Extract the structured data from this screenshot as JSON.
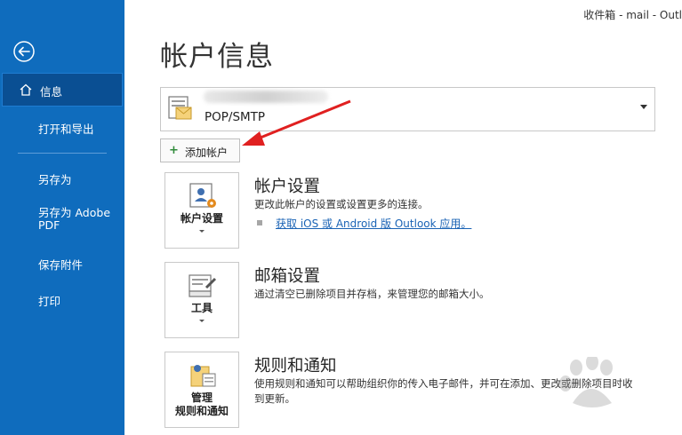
{
  "window": {
    "title": "收件箱 - mail - Outl"
  },
  "sidebar": {
    "items": [
      {
        "label": "信息"
      },
      {
        "label": "打开和导出"
      },
      {
        "label": "另存为"
      },
      {
        "label": "另存为 Adobe\nPDF"
      },
      {
        "label": "保存附件"
      },
      {
        "label": "打印"
      }
    ]
  },
  "page": {
    "title": "帐户信息",
    "account": {
      "type": "POP/SMTP"
    },
    "add_account_label": "添加帐户"
  },
  "sections": {
    "account_settings": {
      "button_label": "帐户设置",
      "title": "帐户设置",
      "description": "更改此帐户的设置或设置更多的连接。",
      "link": "获取 iOS 或 Android 版 Outlook 应用。"
    },
    "mailbox_settings": {
      "button_label": "工具",
      "title": "邮箱设置",
      "description": "通过清空已删除项目并存档，来管理您的邮箱大小。"
    },
    "rules": {
      "button_label": "管理\n规则和通知",
      "title": "规则和通知",
      "description": "使用规则和通知可以帮助组织你的传入电子邮件，并可在添加、更改或删除项目时收\n到更新。"
    }
  },
  "colors": {
    "sidebar": "#0f6cbd",
    "active_nav": "#0a4f93",
    "link": "#1a63b5",
    "annotation_arrow": "#e02020"
  },
  "annotation": {
    "type": "red-arrow",
    "target": "add-account-button"
  }
}
